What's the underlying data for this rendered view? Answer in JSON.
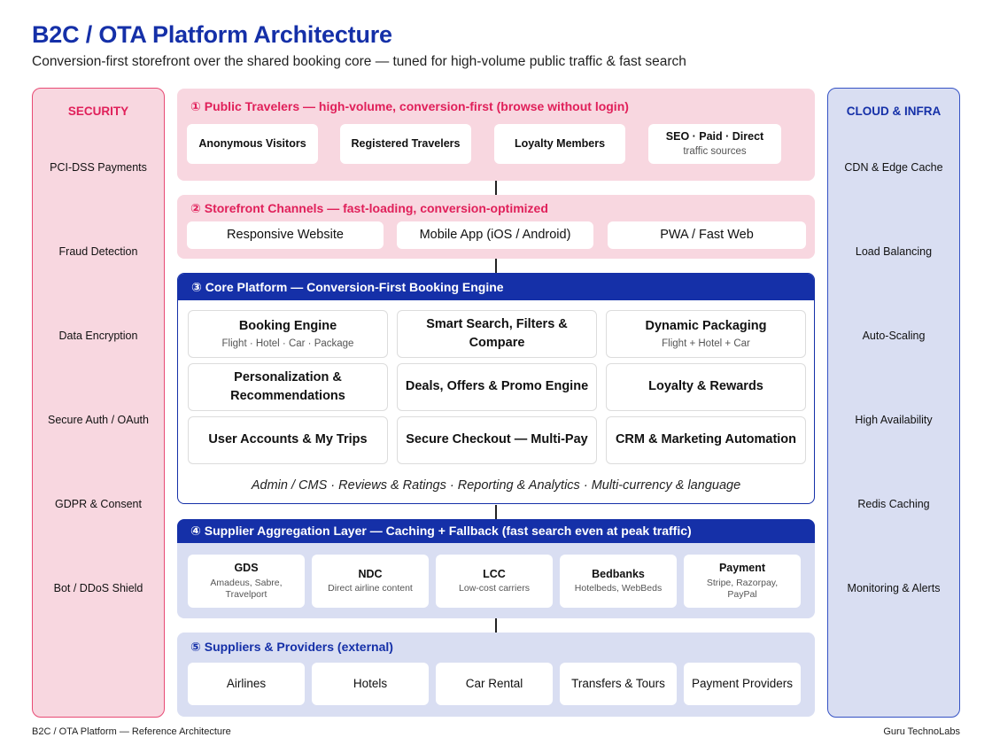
{
  "title": "B2C / OTA Platform Architecture",
  "subtitle": "Conversion-first storefront over the shared booking core — tuned for high-volume public traffic & fast search",
  "security": {
    "title": "SECURITY",
    "items": [
      "PCI-DSS Payments",
      "Fraud Detection",
      "Data Encryption",
      "Secure Auth / OAuth",
      "GDPR & Consent",
      "Bot / DDoS Shield"
    ]
  },
  "infra": {
    "title": "CLOUD & INFRA",
    "items": [
      "CDN & Edge Cache",
      "Load Balancing",
      "Auto-Scaling",
      "High Availability",
      "Redis Caching",
      "Monitoring & Alerts"
    ]
  },
  "layer1": {
    "title": "① Public Travelers — high-volume, conversion-first (browse without login)",
    "cards": [
      {
        "main": "Anonymous Visitors",
        "sub": ""
      },
      {
        "main": "Registered Travelers",
        "sub": ""
      },
      {
        "main": "Loyalty Members",
        "sub": ""
      },
      {
        "main": "SEO · Paid · Direct",
        "sub": "traffic sources"
      }
    ]
  },
  "layer2": {
    "title": "② Storefront Channels — fast-loading, conversion-optimized",
    "cards": [
      "Responsive Website",
      "Mobile App (iOS / Android)",
      "PWA / Fast Web"
    ]
  },
  "layer3": {
    "title": "③ Core Platform — Conversion-First Booking Engine",
    "cards": [
      {
        "main": "Booking Engine",
        "sub": "Flight · Hotel · Car · Package"
      },
      {
        "main": "Smart Search, Filters & Compare",
        "sub": ""
      },
      {
        "main": "Dynamic Packaging",
        "sub": "Flight + Hotel + Car"
      },
      {
        "main": "Personalization & Recommendations",
        "sub": ""
      },
      {
        "main": "Deals, Offers & Promo Engine",
        "sub": ""
      },
      {
        "main": "Loyalty & Rewards",
        "sub": ""
      },
      {
        "main": "User Accounts & My Trips",
        "sub": ""
      },
      {
        "main": "Secure Checkout — Multi-Pay",
        "sub": ""
      },
      {
        "main": "CRM & Marketing Automation",
        "sub": ""
      }
    ],
    "footer": "Admin / CMS · Reviews & Ratings · Reporting & Analytics · Multi-currency & language"
  },
  "layer4": {
    "title": "④ Supplier Aggregation Layer — Caching + Fallback (fast search even at peak traffic)",
    "cards": [
      {
        "main": "GDS",
        "sub": "Amadeus, Sabre, Travelport"
      },
      {
        "main": "NDC",
        "sub": "Direct airline content"
      },
      {
        "main": "LCC",
        "sub": "Low-cost carriers"
      },
      {
        "main": "Bedbanks",
        "sub": "Hotelbeds, WebBeds"
      },
      {
        "main": "Payment",
        "sub": "Stripe, Razorpay, PayPal"
      }
    ]
  },
  "layer5": {
    "title": "⑤ Suppliers & Providers (external)",
    "cards": [
      "Airlines",
      "Hotels",
      "Car Rental",
      "Transfers & Tours",
      "Payment Providers"
    ]
  },
  "footer": {
    "left": "B2C / OTA Platform — Reference Architecture",
    "right": "Guru TechnoLabs"
  },
  "colors": {
    "brand_blue": "#1530a8",
    "accent_pink": "#e0205a",
    "pink_fill": "#f8d7e0",
    "blue_fill": "#d9def2"
  }
}
